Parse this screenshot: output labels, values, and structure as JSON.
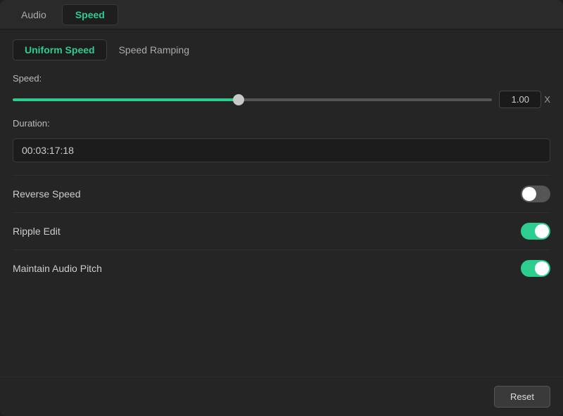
{
  "tabs": {
    "items": [
      {
        "id": "audio",
        "label": "Audio",
        "active": false
      },
      {
        "id": "speed",
        "label": "Speed",
        "active": true
      }
    ]
  },
  "sub_tabs": {
    "items": [
      {
        "id": "uniform",
        "label": "Uniform Speed",
        "active": true
      },
      {
        "id": "ramping",
        "label": "Speed Ramping",
        "active": false
      }
    ]
  },
  "speed_section": {
    "label": "Speed:",
    "value": "1.00",
    "slider_percent": 47,
    "x_label": "X"
  },
  "duration_section": {
    "label": "Duration:",
    "value": "00:03:17:18"
  },
  "toggles": [
    {
      "id": "reverse-speed",
      "label": "Reverse Speed",
      "state": "off"
    },
    {
      "id": "ripple-edit",
      "label": "Ripple Edit",
      "state": "on"
    },
    {
      "id": "maintain-pitch",
      "label": "Maintain Audio Pitch",
      "state": "on"
    }
  ],
  "footer": {
    "reset_label": "Reset"
  },
  "colors": {
    "accent": "#2dcc8f",
    "bg_dark": "#1c1c1c",
    "bg_mid": "#252525",
    "text_primary": "#d0d0d0"
  }
}
